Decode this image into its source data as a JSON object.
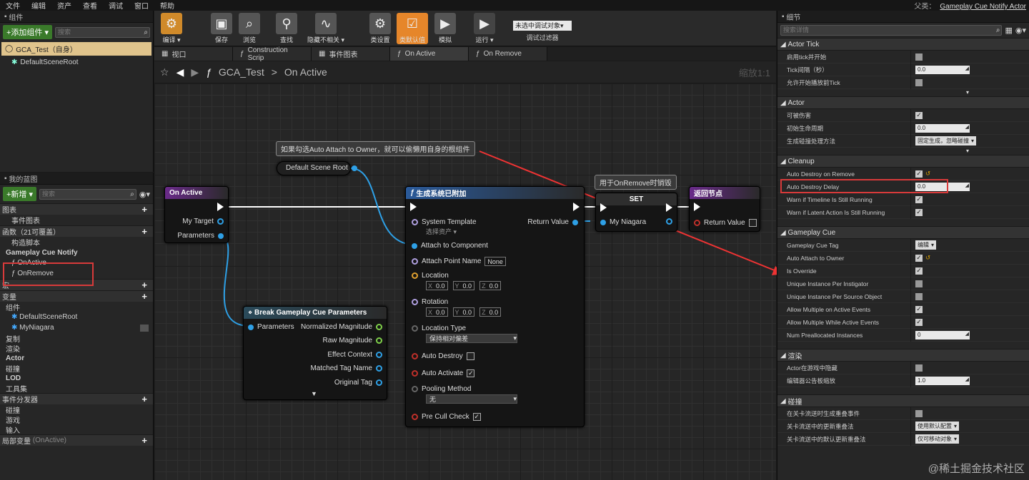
{
  "menubar": {
    "items": [
      "文件",
      "编辑",
      "资产",
      "查看",
      "调试",
      "窗口",
      "帮助"
    ],
    "parent_label": "父类：",
    "parent_class": "Gameplay Cue Notify Actor"
  },
  "components": {
    "header": "组件",
    "add_button": "+添加组件 ▾",
    "search_placeholder": "搜索",
    "selected": "GCA_Test（自身）",
    "root": "DefaultSceneRoot"
  },
  "mybp": {
    "header": "我的蓝图",
    "new_button": "+新增 ▾",
    "search_placeholder": "搜索",
    "graphs": "图表",
    "event_graph": "事件图表",
    "functions": "函数（21可覆盖）",
    "construct": "构造脚本",
    "gcn": "Gameplay Cue Notify",
    "on_active": "OnActive",
    "on_remove": "OnRemove",
    "macros": "宏",
    "variables": "变量",
    "comp_cat": "组件",
    "var1": "DefaultSceneRoot",
    "var2": "MyNiagara",
    "cats": [
      "复制",
      "渲染",
      "Actor",
      "碰撞",
      "LOD",
      "工具集"
    ],
    "dispatchers": "事件分发器",
    "disp_items": [
      "碰撞",
      "游戏",
      "输入"
    ],
    "local_vars": "局部变量",
    "local_ctx": "(OnActive)"
  },
  "toolbar": {
    "compile": "编译",
    "save": "保存",
    "browse": "浏览",
    "find": "查找",
    "hide": "隐藏不相关",
    "class_settings": "类设置",
    "class_defaults": "类默认值",
    "simulate": "模拟",
    "run": "运行",
    "debug_combo": "未选中调试对象▾",
    "debug_filter": "调试过滤器"
  },
  "tabs": [
    "视口",
    "Construction Scrip",
    "事件图表",
    "On Active",
    "On Remove"
  ],
  "crumb": {
    "bp": "GCA_Test",
    "sep": ">",
    "fn": "On Active",
    "zoom": "缩放1:1"
  },
  "graph": {
    "comment1": "如果勾选Auto Attach to Owner，就可以偷懒用自身的根组件",
    "comment2": "用于OnRemove时销毁",
    "dsr": "Default Scene Root",
    "entry": {
      "title": "On Active",
      "my_target": "My Target",
      "params": "Parameters"
    },
    "spawn": {
      "title": "生成系统已附加",
      "sys_template": "System Template",
      "select_asset": "选择资产 ▾",
      "attach": "Attach to Component",
      "attach_point": "Attach Point Name",
      "none": "None",
      "location": "Location",
      "rotation": "Rotation",
      "x": "X",
      "y": "Y",
      "z": "Z",
      "zero": "0.0",
      "loc_type": "Location Type",
      "loc_type_val": "保持相对偏差",
      "auto_destroy": "Auto Destroy",
      "auto_activate": "Auto Activate",
      "pooling": "Pooling Method",
      "pooling_val": "无",
      "precull": "Pre Cull Check",
      "return_value": "Return Value"
    },
    "set": {
      "title": "SET",
      "var": "My Niagara"
    },
    "ret": {
      "title": "返回节点",
      "rv": "Return Value"
    },
    "brk": {
      "title": "Break Gameplay Cue Parameters",
      "params": "Parameters",
      "nm": "Normalized Magnitude",
      "rm": "Raw Magnitude",
      "ec": "Effect Context",
      "mt": "Matched Tag Name",
      "ot": "Original Tag"
    }
  },
  "details": {
    "header": "细节",
    "search_placeholder": "搜索详情",
    "sec_tick": "Actor Tick",
    "tick1": "启用tick并开始",
    "tick2": "Tick间隔（秒）",
    "tick2v": "0.0",
    "tick3": "允许开始播放前Tick",
    "sec_actor": "Actor",
    "a1": "可被伤害",
    "a2": "初始生命周期",
    "a2v": "0.0",
    "a3": "生成碰撞处理方法",
    "a3v": "固定生成，忽略碰撞",
    "sec_cleanup": "Cleanup",
    "c1": "Auto Destroy on Remove",
    "c2": "Auto Destroy Delay",
    "c2v": "0.0",
    "c3": "Warn if Timeline Is Still Running",
    "c4": "Warn if Latent Action Is Still Running",
    "sec_gc": "Gameplay Cue",
    "g1": "Gameplay Cue Tag",
    "g1v": "编辑",
    "g2": "Auto Attach to Owner",
    "g3": "Is Override",
    "g4": "Unique Instance Per Instigator",
    "g5": "Unique Instance Per Source Object",
    "g6": "Allow Multiple on Active Events",
    "g7": "Allow Multiple While Active Events",
    "g8": "Num Preallocated Instances",
    "g8v": "0",
    "sec_render": "渲染",
    "r1": "Actor在游戏中隐藏",
    "r2": "编辑器公告板缩放",
    "r2v": "1.0",
    "sec_col": "碰撞",
    "k1": "在关卡流送时生成重叠事件",
    "k2": "关卡流送中的更新重叠法",
    "k2v": "使用默认配置",
    "k3": "关卡流送中的默认更新重叠法",
    "k3v": "仅可移动对象"
  },
  "watermark": "@稀土掘金技术社区"
}
